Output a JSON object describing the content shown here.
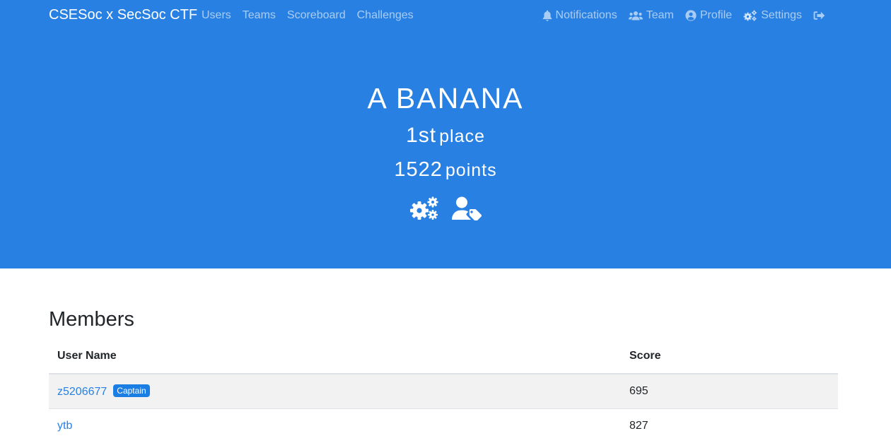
{
  "nav": {
    "brand": "CSESoc x SecSoc CTF",
    "left_links": [
      {
        "label": "Users"
      },
      {
        "label": "Teams"
      },
      {
        "label": "Scoreboard"
      },
      {
        "label": "Challenges"
      }
    ],
    "right_links": [
      {
        "label": "Notifications",
        "icon": "bell-icon"
      },
      {
        "label": "Team",
        "icon": "users-icon"
      },
      {
        "label": "Profile",
        "icon": "user-circle-icon"
      },
      {
        "label": "Settings",
        "icon": "cogs-icon"
      }
    ],
    "logout_icon": "sign-out-icon"
  },
  "team": {
    "name": "A BANANA",
    "place_number": "1st",
    "place_word": "place",
    "points_number": "1522",
    "points_word": "points",
    "actions": [
      {
        "icon": "cogs-icon"
      },
      {
        "icon": "user-tag-icon"
      }
    ]
  },
  "members": {
    "title": "Members",
    "columns": [
      "User Name",
      "Score"
    ],
    "rows": [
      {
        "name": "z5206677",
        "badge": "Captain",
        "score": "695"
      },
      {
        "name": "ytb",
        "badge": "",
        "score": "827"
      }
    ]
  },
  "colors": {
    "primary": "#2880e2",
    "badge": "#1b7ee3",
    "stripe": "#f2f2f2"
  }
}
